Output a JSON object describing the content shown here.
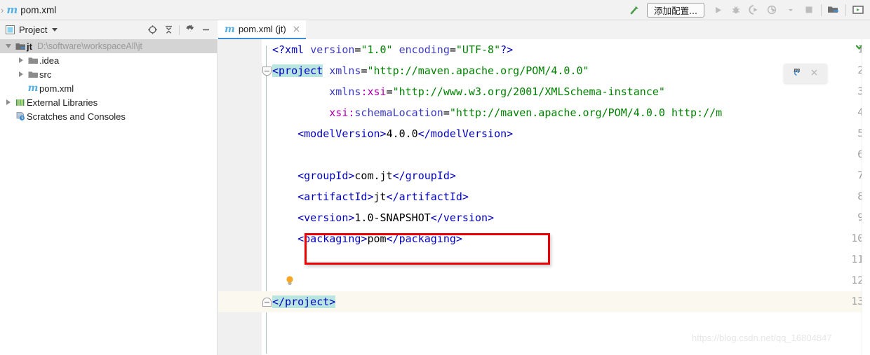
{
  "window": {
    "breadcrumb": {
      "separator": "›",
      "file_icon": "maven-file-icon",
      "file": "pom.xml"
    }
  },
  "toolbar": {
    "build_icon": "hammer-build-icon",
    "add_config_label": "添加配置...",
    "run_icon": "run-icon",
    "debug_icon": "debug-icon",
    "run_coverage_icon": "run-with-coverage-icon",
    "profile_icon": "profiler-icon",
    "profile_dropdown_icon": "chevron-down-icon",
    "stop_icon": "stop-icon",
    "project_structure_icon": "project-structure-icon",
    "search_everywhere_icon": "terminal-icon"
  },
  "project_panel": {
    "title": "Project",
    "dropdown_icon": "chevron-down-icon",
    "locate_icon": "scroll-from-source-icon",
    "collapse_icon": "collapse-all-icon",
    "settings_icon": "gear-icon",
    "hide_icon": "minimize-icon",
    "tree": [
      {
        "label": "jt",
        "path": "D:\\software\\workspaceAll\\jt",
        "icon": "project-folder-icon",
        "indent": 0,
        "expanded": true,
        "bold": true,
        "selected": true
      },
      {
        "label": ".idea",
        "path": "",
        "icon": "folder-icon",
        "indent": 1,
        "expanded": false,
        "bold": false,
        "selected": false
      },
      {
        "label": "src",
        "path": "",
        "icon": "folder-icon",
        "indent": 1,
        "expanded": false,
        "bold": false,
        "selected": false
      },
      {
        "label": "pom.xml",
        "path": "",
        "icon": "maven-file-icon",
        "indent": 1,
        "expanded": null,
        "bold": false,
        "selected": false
      },
      {
        "label": "External Libraries",
        "path": "",
        "icon": "libraries-icon",
        "indent": 0,
        "expanded": false,
        "bold": false,
        "selected": false
      },
      {
        "label": "Scratches and Consoles",
        "path": "",
        "icon": "scratches-icon",
        "indent": 0,
        "expanded": null,
        "bold": false,
        "selected": false
      }
    ]
  },
  "editor": {
    "tab": {
      "icon": "maven-file-icon",
      "label": "pom.xml (jt)",
      "close_icon": "close-icon"
    },
    "inspection_status_icon": "inspection-ok-check-icon",
    "maven_popup": {
      "reload_icon": "maven-reload-icon",
      "close_icon": "close-icon"
    },
    "intention_bulb_icon": "intention-lightbulb-icon",
    "line_numbers": [
      "1",
      "2",
      "3",
      "4",
      "5",
      "6",
      "7",
      "8",
      "9",
      "10",
      "11",
      "12",
      "13"
    ],
    "caret_line": 13,
    "code": [
      {
        "n": 1,
        "tokens": [
          {
            "t": "<?xml ",
            "c": "pi"
          },
          {
            "t": "version",
            "c": "attr"
          },
          {
            "t": "=",
            "c": "eq"
          },
          {
            "t": "\"1.0\"",
            "c": "val"
          },
          {
            "t": " ",
            "c": "txt"
          },
          {
            "t": "encoding",
            "c": "attr"
          },
          {
            "t": "=",
            "c": "eq"
          },
          {
            "t": "\"UTF-8\"",
            "c": "val"
          },
          {
            "t": "?>",
            "c": "pi"
          }
        ]
      },
      {
        "n": 2,
        "tokens": [
          {
            "t": "<project",
            "c": "tag hl-tag"
          },
          {
            "t": " ",
            "c": "txt"
          },
          {
            "t": "xmlns",
            "c": "attr"
          },
          {
            "t": "=",
            "c": "eq"
          },
          {
            "t": "\"http://maven.apache.org/POM/4.0.0\"",
            "c": "val"
          }
        ]
      },
      {
        "n": 3,
        "tokens": [
          {
            "t": "         ",
            "c": "txt"
          },
          {
            "t": "xmlns",
            "c": "attr"
          },
          {
            "t": ":",
            "c": "ns"
          },
          {
            "t": "xsi",
            "c": "ns"
          },
          {
            "t": "=",
            "c": "eq"
          },
          {
            "t": "\"http://www.w3.org/2001/XMLSchema-instance\"",
            "c": "val"
          }
        ]
      },
      {
        "n": 4,
        "tokens": [
          {
            "t": "         ",
            "c": "txt"
          },
          {
            "t": "xsi",
            "c": "ns"
          },
          {
            "t": ":",
            "c": "ns"
          },
          {
            "t": "schemaLocation",
            "c": "attr"
          },
          {
            "t": "=",
            "c": "eq"
          },
          {
            "t": "\"http://maven.apache.org/POM/4.0.0 http://m",
            "c": "val"
          }
        ]
      },
      {
        "n": 5,
        "tokens": [
          {
            "t": "    ",
            "c": "txt"
          },
          {
            "t": "<modelVersion>",
            "c": "tag"
          },
          {
            "t": "4.0.0",
            "c": "txt"
          },
          {
            "t": "</modelVersion>",
            "c": "tag"
          }
        ]
      },
      {
        "n": 6,
        "tokens": []
      },
      {
        "n": 7,
        "tokens": [
          {
            "t": "    ",
            "c": "txt"
          },
          {
            "t": "<groupId>",
            "c": "tag"
          },
          {
            "t": "com.jt",
            "c": "txt"
          },
          {
            "t": "</groupId>",
            "c": "tag"
          }
        ]
      },
      {
        "n": 8,
        "tokens": [
          {
            "t": "    ",
            "c": "txt"
          },
          {
            "t": "<artifactId>",
            "c": "tag"
          },
          {
            "t": "jt",
            "c": "txt"
          },
          {
            "t": "</artifactId>",
            "c": "tag"
          }
        ]
      },
      {
        "n": 9,
        "tokens": [
          {
            "t": "    ",
            "c": "txt"
          },
          {
            "t": "<version>",
            "c": "tag"
          },
          {
            "t": "1.0-SNAPSHOT",
            "c": "txt"
          },
          {
            "t": "</version>",
            "c": "tag"
          }
        ]
      },
      {
        "n": 10,
        "tokens": [
          {
            "t": "    ",
            "c": "txt"
          },
          {
            "t": "<packaging>",
            "c": "tag"
          },
          {
            "t": "pom",
            "c": "txt"
          },
          {
            "t": "</packaging>",
            "c": "tag"
          }
        ]
      },
      {
        "n": 11,
        "tokens": []
      },
      {
        "n": 12,
        "tokens": []
      },
      {
        "n": 13,
        "tokens": [
          {
            "t": "</project",
            "c": "tag hl-tag"
          },
          {
            "t": ">",
            "c": "tag hl-tag"
          }
        ]
      }
    ]
  },
  "annotation": {
    "highlight_line": 10,
    "color": "#ef0000"
  },
  "watermark": {
    "text": "https://blog.csdn.net/qq_16804847"
  }
}
